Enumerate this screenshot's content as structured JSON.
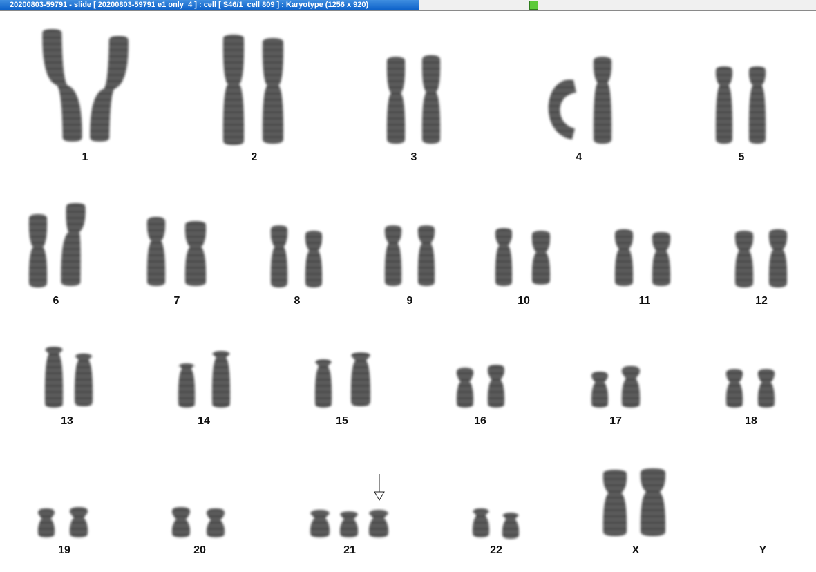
{
  "window": {
    "title": "20200803-59791 - slide [ 20200803-59791 e1 only_4 ] : cell [ S46/1_cell 809 ] : Karyotype  (1256 x 920)",
    "status_color": "#5cc93a"
  },
  "karyotype": {
    "chromosomes": [
      {
        "label": "1"
      },
      {
        "label": "2"
      },
      {
        "label": "3"
      },
      {
        "label": "4"
      },
      {
        "label": "5"
      },
      {
        "label": "6"
      },
      {
        "label": "7"
      },
      {
        "label": "8"
      },
      {
        "label": "9"
      },
      {
        "label": "10"
      },
      {
        "label": "11"
      },
      {
        "label": "12"
      },
      {
        "label": "13"
      },
      {
        "label": "14"
      },
      {
        "label": "15"
      },
      {
        "label": "16"
      },
      {
        "label": "17"
      },
      {
        "label": "18"
      },
      {
        "label": "19"
      },
      {
        "label": "20"
      },
      {
        "label": "21"
      },
      {
        "label": "22"
      },
      {
        "label": "X"
      },
      {
        "label": "Y"
      }
    ],
    "marker_icon": "arrow-down-icon"
  }
}
